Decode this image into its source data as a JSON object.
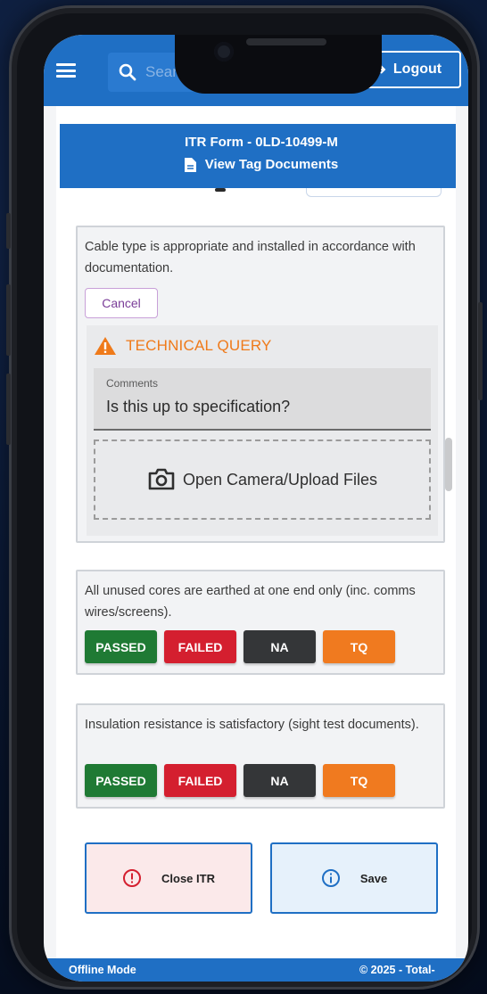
{
  "header": {
    "search_placeholder": "Search",
    "logout_label": "Logout"
  },
  "itr": {
    "title": "ITR Form - 0LD-10499-M",
    "view_docs_label": "View Tag Documents"
  },
  "checks": [
    {
      "question": "Cable type is appropriate and installed in accordance with documentation.",
      "cancel_label": "Cancel",
      "tq_heading": "TECHNICAL QUERY",
      "comments_label": "Comments",
      "comments_value": "Is this up to specification?",
      "upload_label": "Open Camera/Upload Files"
    },
    {
      "question": "All unused cores are earthed at one end only (inc. comms wires/screens).",
      "buttons": [
        "PASSED",
        "FAILED",
        "NA",
        "TQ"
      ]
    },
    {
      "question": "Insulation resistance is satisfactory (sight test documents).",
      "buttons": [
        "PASSED",
        "FAILED",
        "NA",
        "TQ"
      ]
    }
  ],
  "actions": {
    "close_label": "Close ITR",
    "save_label": "Save"
  },
  "footer": {
    "mode": "Offline Mode",
    "copyright": "© 2025 - Total-"
  },
  "colors": {
    "primary": "#1f6fc4",
    "passed": "#1f7a34",
    "failed": "#d41f2f",
    "na": "#343638",
    "tq": "#f07a1f"
  }
}
